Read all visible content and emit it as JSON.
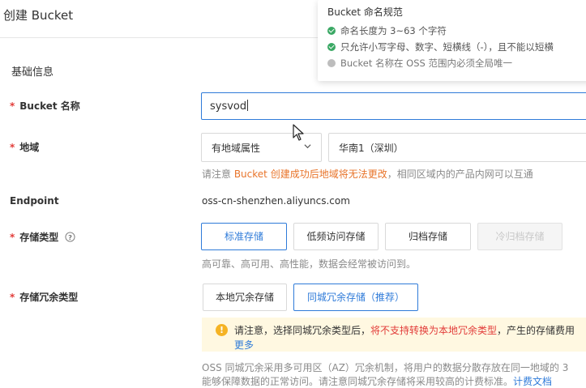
{
  "page": {
    "title": "创建 Bucket"
  },
  "section": {
    "basic": "基础信息"
  },
  "bucket_name": {
    "label": "Bucket 名称",
    "value": "sysvod"
  },
  "region": {
    "label": "地域",
    "type_select": "有地域属性",
    "region_select": "华南1（深圳）",
    "hint_prefix": "请注意 ",
    "hint_warn": "Bucket 创建成功后地域将无法更改",
    "hint_suffix": "，相同区域内的产品内网可以互通"
  },
  "endpoint": {
    "label": "Endpoint",
    "value": "oss-cn-shenzhen.aliyuncs.com"
  },
  "storage_class": {
    "label": "存储类型",
    "options": [
      "标准存储",
      "低频访问存储",
      "归档存储",
      "冷归档存储"
    ],
    "selected": "标准存储",
    "hint": "高可靠、高可用、高性能，数据会经常被访问到。"
  },
  "redundancy": {
    "label": "存储冗余类型",
    "options": [
      "本地冗余存储",
      "同城冗余存储（推荐）"
    ],
    "selected": "同城冗余存储（推荐）",
    "alert_prefix": "请注意，选择同城冗余类型后，",
    "alert_warn": "将不支持转换为本地冗余类型",
    "alert_suffix": "，产生的存储费用",
    "alert_more": "更多",
    "desc_line1": "OSS 同城冗余采用多可用区（AZ）冗余机制，将用户的数据分散存放在同一地域的 3",
    "desc_line2": "能够保障数据的正常访问。请注意同城冗余存储将采用较高的计费标准。",
    "desc_link": "计费文档"
  },
  "naming_popup": {
    "title": "Bucket 命名规范",
    "rules": [
      {
        "text": "命名长度为 3~63 个字符",
        "status": "ok"
      },
      {
        "text": "只允许小写字母、数字、短横线（-），且不能以短横",
        "status": "ok"
      },
      {
        "text": "Bucket 名称在 OSS 范围内必须全局唯一",
        "status": "pending"
      }
    ]
  },
  "colors": {
    "accent": "#2f7bd9",
    "required": "#e23c39",
    "warning": "#e8742a",
    "success": "#3aa864"
  }
}
